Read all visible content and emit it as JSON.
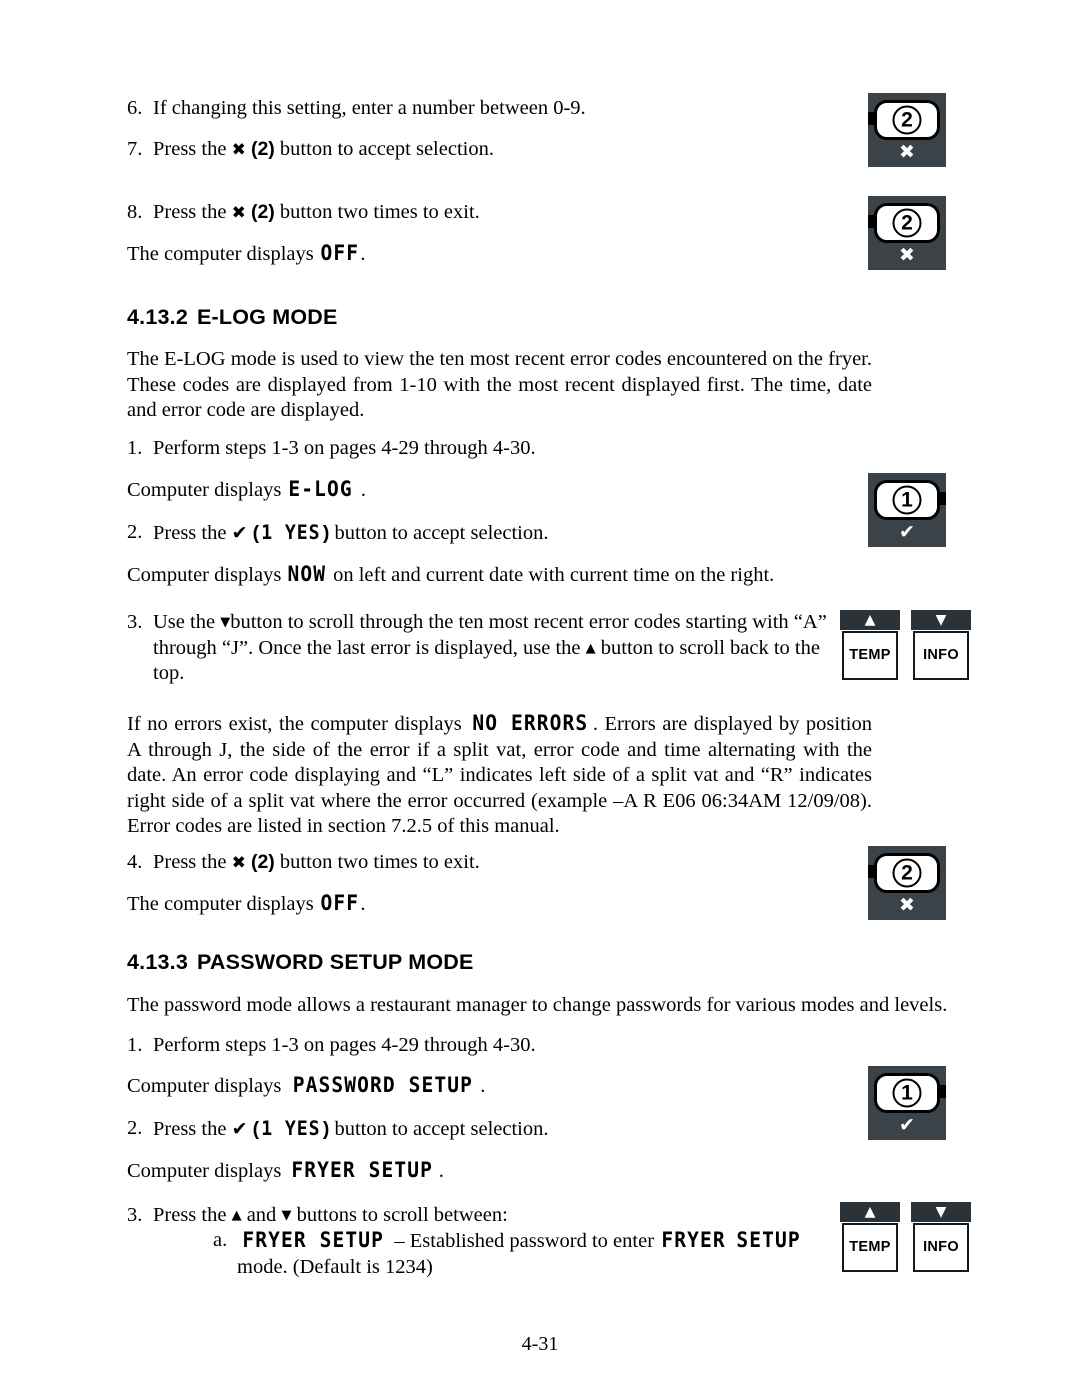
{
  "page": {
    "footer_page_number": "4-31"
  },
  "top_steps": {
    "step6": {
      "marker": "6.",
      "text": "If changing this setting, enter a number between 0-9."
    },
    "step7": {
      "marker": "7.",
      "before": "Press the",
      "x_symbol": "✖",
      "paren": "(2)",
      "after": "button to accept selection."
    },
    "step8": {
      "marker": "8.",
      "before": "Press the",
      "x_symbol": "✖",
      "paren": "(2)",
      "after": "button two times to exit."
    },
    "display_off": {
      "before": "The computer displays",
      "lcd": "OFF",
      "after": "."
    }
  },
  "section_elog": {
    "heading_number": "4.13.2",
    "heading_title": "E-LOG MODE",
    "intro": "The E-LOG mode is used to view the ten most recent error codes encountered on the fryer.  These codes are displayed from 1-10 with the most recent displayed first.  The time, date and error code are displayed.",
    "step1": {
      "marker": "1.",
      "text": "Perform steps 1-3 on pages 4-29 through 4-30."
    },
    "display_elog": {
      "before": "Computer displays",
      "lcd": "E-LOG",
      "after": "."
    },
    "step2": {
      "marker": "2.",
      "before": "Press the",
      "check_symbol": "✔",
      "open_paren": "(",
      "lcd": "1 YES",
      "close_paren": ")",
      "after": "button to accept selection."
    },
    "display_now": {
      "before": "Computer displays",
      "lcd": "NOW",
      "after": "on left and current date with current time on the right."
    },
    "step3": {
      "marker": "3.",
      "part1": "Use the",
      "down_symbol": "▼",
      "part2": "button  to scroll through the ten most recent error codes starting with “A” through “J”.  Once the last error is displayed, use the",
      "up_symbol": "▲",
      "part3": "button to scroll back to the top."
    },
    "no_errors_para": {
      "before": "If no errors exist, the computer displays",
      "lcd": "NO ERRORS",
      "after": ". Errors are displayed by position A through J, the side of the error if a split vat, error code and time alternating with the date.  An error code displaying and “L” indicates left side of a split vat and “R” indicates right side of a split vat where the error occurred (example –A   R E06  06:34AM    12/09/08).  Error codes are listed in section 7.2.5 of this manual."
    },
    "step4": {
      "marker": "4.",
      "before": "Press the",
      "x_symbol": "✖",
      "paren": "(2)",
      "after": "button two times to exit."
    },
    "display_off": {
      "before": "The computer displays",
      "lcd": "OFF",
      "after": "."
    }
  },
  "section_password": {
    "heading_number": "4.13.3",
    "heading_title": "PASSWORD SETUP MODE",
    "intro": "The password mode allows a restaurant manager to change passwords for various modes and levels.",
    "step1": {
      "marker": "1.",
      "text": "Perform steps 1-3 on pages 4-29 through 4-30."
    },
    "display_password_setup": {
      "before": "Computer displays",
      "lcd": "PASSWORD SETUP",
      "after": "."
    },
    "step2": {
      "marker": "2.",
      "before": "Press the",
      "check_symbol": "✔",
      "open_paren": "(",
      "lcd": "1 YES",
      "close_paren": ")",
      "after": "button to accept selection."
    },
    "display_fryer_setup": {
      "before": "Computer displays",
      "lcd": "FRYER SETUP",
      "after": "."
    },
    "step3": {
      "marker": "3.",
      "part1": "Press the",
      "up_symbol": "▲",
      "part2": "and",
      "down_symbol": "▼",
      "part3": "buttons to scroll between:"
    },
    "substep_a": {
      "marker": "a.",
      "lcd1": "FRYER SETUP",
      "mid": "– Established password to enter",
      "lcd2": "FRYER",
      "lcd3": "SETUP",
      "tail": "mode. (Default is 1234)"
    }
  },
  "keys": {
    "key2_label": "2",
    "key2_sub": "✖",
    "key1_label": "1",
    "key1_sub": "✔",
    "temp_label": "TEMP",
    "temp_arrow": "▲",
    "info_label": "INFO",
    "info_arrow": "▼"
  }
}
